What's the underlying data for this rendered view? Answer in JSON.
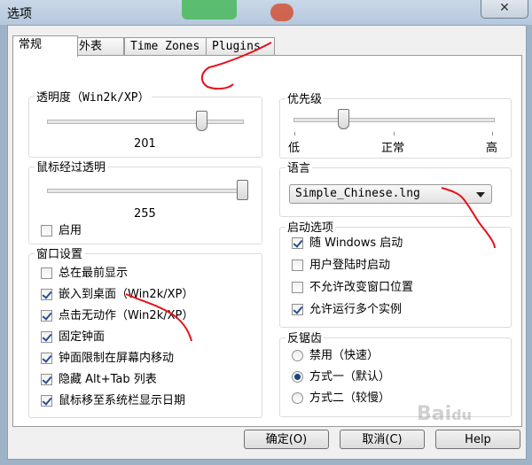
{
  "window": {
    "title": "选项",
    "close_glyph": "✕"
  },
  "tabs": [
    "常规",
    "外表",
    "Time Zones",
    "Plugins"
  ],
  "transparency": {
    "label": "透明度（Win2k/XP）",
    "value": "201",
    "level_percent": 79
  },
  "hover": {
    "label": "鼠标经过透明",
    "value": "255",
    "level_percent": 100,
    "enable": {
      "label": "启用",
      "checked": false
    }
  },
  "window_settings": {
    "label": "窗口设置",
    "items": [
      {
        "label": "总在最前显示",
        "checked": false
      },
      {
        "label": "嵌入到桌面（Win2k/XP）",
        "checked": true
      },
      {
        "label": "点击无动作（Win2k/XP）",
        "checked": true
      },
      {
        "label": "固定钟面",
        "checked": true
      },
      {
        "label": "钟面限制在屏幕内移动",
        "checked": true
      },
      {
        "label": "隐藏 Alt+Tab 列表",
        "checked": true
      },
      {
        "label": "鼠标移至系统栏显示日期",
        "checked": true
      }
    ]
  },
  "priority": {
    "label": "优先级",
    "low": "低",
    "normal": "正常",
    "high": "高",
    "level_percent": 25
  },
  "language": {
    "label": "语言",
    "selected": "Simple_Chinese.lng"
  },
  "startup": {
    "label": "启动选项",
    "items": [
      {
        "label": "随 Windows 启动",
        "checked": true
      },
      {
        "label": "用户登陆时启动",
        "checked": false
      },
      {
        "label": "不允许改变窗口位置",
        "checked": false
      },
      {
        "label": "允许运行多个实例",
        "checked": true
      }
    ]
  },
  "antialias": {
    "label": "反锯齿",
    "options": [
      {
        "label": "禁用（快速）",
        "selected": false
      },
      {
        "label": "方式一（默认）",
        "selected": true
      },
      {
        "label": "方式二（较慢）",
        "selected": false
      }
    ]
  },
  "buttons": {
    "ok": "确定(O)",
    "cancel": "取消(C)",
    "help": "Help"
  },
  "watermark": "Baidu",
  "colors": {
    "annotation": "#e8101a",
    "accent": "#1c3f86"
  }
}
